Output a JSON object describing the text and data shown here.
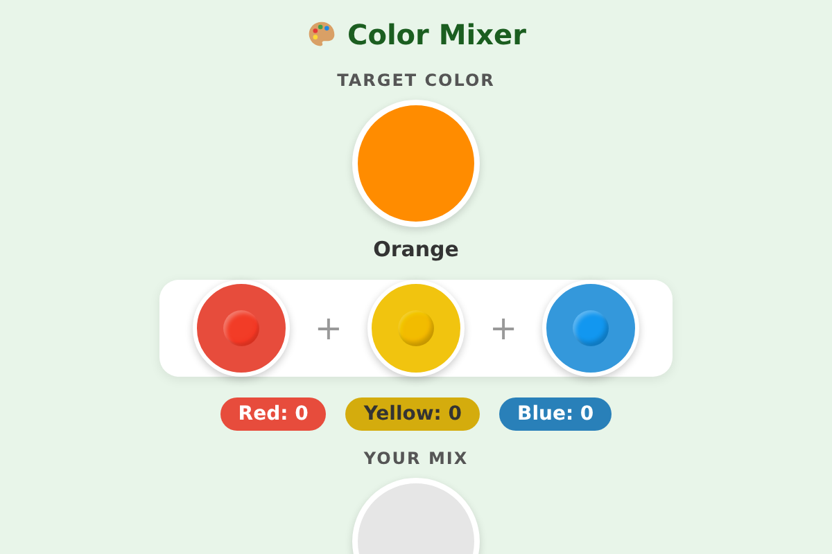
{
  "title": "Color Mixer",
  "target": {
    "label": "TARGET COLOR",
    "color": "#ff8c00",
    "name": "Orange"
  },
  "paints": [
    {
      "color": "#e74c3c"
    },
    {
      "color": "#f1c40f"
    },
    {
      "color": "#3498db"
    }
  ],
  "operator": "+",
  "counts": [
    {
      "text": "Red: 0",
      "color": "#e74c3c"
    },
    {
      "text": "Yellow: 0",
      "color": "#d4ac0d"
    },
    {
      "text": "Blue: 0",
      "color": "#2980b9"
    }
  ],
  "mix": {
    "label": "YOUR MIX",
    "color": "#e6e6e6"
  }
}
